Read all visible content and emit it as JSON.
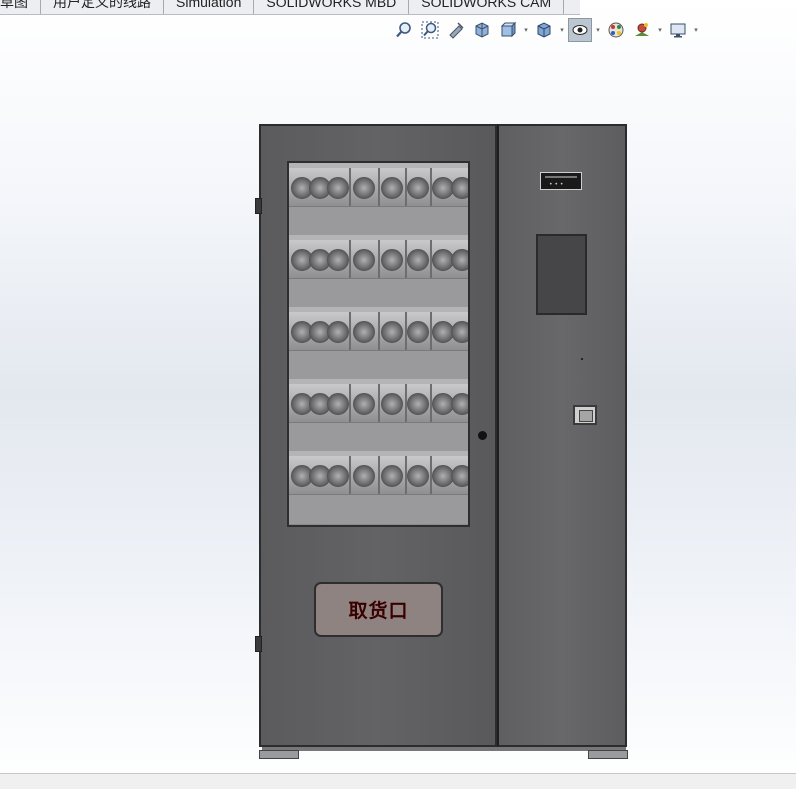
{
  "tabs": [
    "草图",
    "用户定义的线路",
    "Simulation",
    "SOLIDWORKS MBD",
    "SOLIDWORKS CAM"
  ],
  "heads_up_toolbar": [
    {
      "icon": "zoom-to-fit-icon"
    },
    {
      "icon": "zoom-to-area-icon"
    },
    {
      "icon": "previous-view-icon"
    },
    {
      "icon": "section-view-icon"
    },
    {
      "icon": "view-orientation-icon",
      "dropdown": true
    },
    {
      "icon": "display-style-icon",
      "dropdown": true
    },
    {
      "icon": "hide-show-items-icon",
      "dropdown": true,
      "active": true
    },
    {
      "icon": "edit-appearance-icon"
    },
    {
      "icon": "apply-scene-icon",
      "dropdown": true
    },
    {
      "icon": "view-settings-icon",
      "dropdown": true
    }
  ],
  "model": {
    "pickup_label": "取货口"
  },
  "colors": {
    "machine_body": "#636365",
    "pickup_label": "#3a0000",
    "active_tool": "#bcc6d1"
  }
}
